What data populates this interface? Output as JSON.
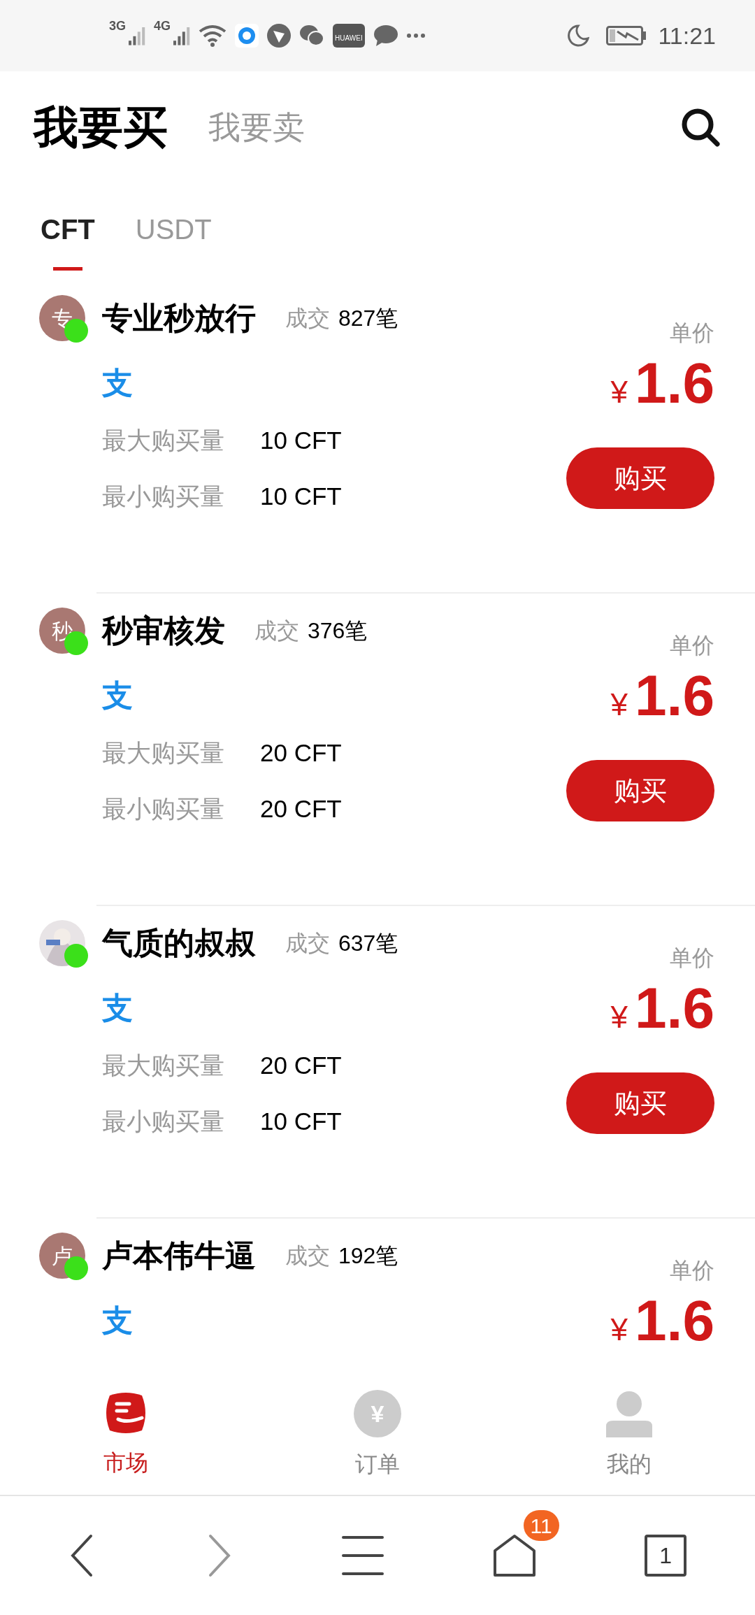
{
  "status_bar": {
    "signal_1": "3G",
    "signal_2": "4G",
    "app_label": "HUAWEI",
    "time": "11:21"
  },
  "header": {
    "tabs": [
      {
        "label": "我要买",
        "selected": true
      },
      {
        "label": "我要卖",
        "selected": false
      }
    ]
  },
  "currency_tabs": [
    {
      "label": "CFT",
      "selected": true
    },
    {
      "label": "USDT",
      "selected": false
    }
  ],
  "offers": [
    {
      "avatar": {
        "kind": "letter",
        "text": "专"
      },
      "online": true,
      "name": "专业秒放行",
      "deals_label": "成交",
      "deals": "827笔",
      "payment_icon": "支",
      "price_label": "单价",
      "currency": "¥",
      "price": "1.6",
      "max_label": "最大购买量",
      "max": "10 CFT",
      "min_label": "最小购买量",
      "min": "10 CFT",
      "button": "购买"
    },
    {
      "avatar": {
        "kind": "letter",
        "text": "秒"
      },
      "online": true,
      "name": "秒审核发",
      "deals_label": "成交",
      "deals": "376笔",
      "payment_icon": "支",
      "price_label": "单价",
      "currency": "¥",
      "price": "1.6",
      "max_label": "最大购买量",
      "max": "20 CFT",
      "min_label": "最小购买量",
      "min": "20 CFT",
      "button": "购买"
    },
    {
      "online": true,
      "name": "气质的叔叔",
      "deals_label": "成交",
      "deals": "637笔",
      "payment_icon": "支",
      "price_label": "单价",
      "currency": "¥",
      "price": "1.6",
      "max_label": "最大购买量",
      "max": "20 CFT",
      "min_label": "最小购买量",
      "min": "10 CFT",
      "button": "购买"
    },
    {
      "avatar": {
        "kind": "letter",
        "text": "卢"
      },
      "online": true,
      "name": "卢本伟牛逼",
      "deals_label": "成交",
      "deals": "192笔",
      "payment_icon": "支",
      "price_label": "单价",
      "currency": "¥",
      "price": "1.6"
    }
  ],
  "bottom_nav": [
    {
      "kind": "market",
      "label": "市场",
      "selected": true
    },
    {
      "kind": "orders",
      "label": "订单",
      "icon_text": "¥",
      "selected": false
    },
    {
      "kind": "profile",
      "label": "我的",
      "selected": false
    }
  ],
  "browser_bar": {
    "home_badge": "11",
    "tab_count": "1"
  }
}
